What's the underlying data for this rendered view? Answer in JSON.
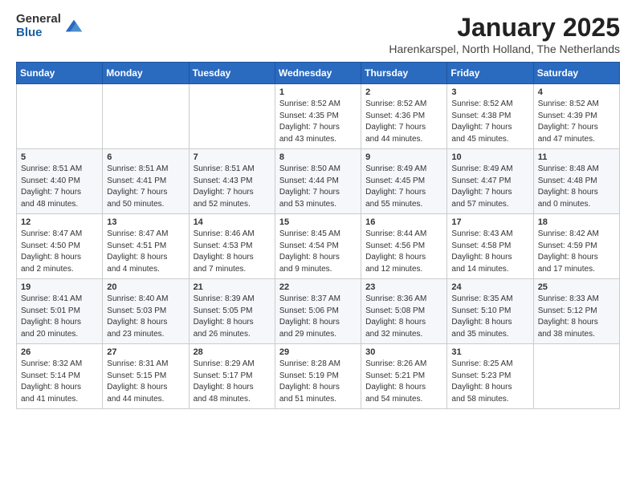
{
  "logo": {
    "general": "General",
    "blue": "Blue"
  },
  "title": "January 2025",
  "subtitle": "Harenkarspel, North Holland, The Netherlands",
  "headers": [
    "Sunday",
    "Monday",
    "Tuesday",
    "Wednesday",
    "Thursday",
    "Friday",
    "Saturday"
  ],
  "weeks": [
    [
      {
        "day": "",
        "content": ""
      },
      {
        "day": "",
        "content": ""
      },
      {
        "day": "",
        "content": ""
      },
      {
        "day": "1",
        "content": "Sunrise: 8:52 AM\nSunset: 4:35 PM\nDaylight: 7 hours\nand 43 minutes."
      },
      {
        "day": "2",
        "content": "Sunrise: 8:52 AM\nSunset: 4:36 PM\nDaylight: 7 hours\nand 44 minutes."
      },
      {
        "day": "3",
        "content": "Sunrise: 8:52 AM\nSunset: 4:38 PM\nDaylight: 7 hours\nand 45 minutes."
      },
      {
        "day": "4",
        "content": "Sunrise: 8:52 AM\nSunset: 4:39 PM\nDaylight: 7 hours\nand 47 minutes."
      }
    ],
    [
      {
        "day": "5",
        "content": "Sunrise: 8:51 AM\nSunset: 4:40 PM\nDaylight: 7 hours\nand 48 minutes."
      },
      {
        "day": "6",
        "content": "Sunrise: 8:51 AM\nSunset: 4:41 PM\nDaylight: 7 hours\nand 50 minutes."
      },
      {
        "day": "7",
        "content": "Sunrise: 8:51 AM\nSunset: 4:43 PM\nDaylight: 7 hours\nand 52 minutes."
      },
      {
        "day": "8",
        "content": "Sunrise: 8:50 AM\nSunset: 4:44 PM\nDaylight: 7 hours\nand 53 minutes."
      },
      {
        "day": "9",
        "content": "Sunrise: 8:49 AM\nSunset: 4:45 PM\nDaylight: 7 hours\nand 55 minutes."
      },
      {
        "day": "10",
        "content": "Sunrise: 8:49 AM\nSunset: 4:47 PM\nDaylight: 7 hours\nand 57 minutes."
      },
      {
        "day": "11",
        "content": "Sunrise: 8:48 AM\nSunset: 4:48 PM\nDaylight: 8 hours\nand 0 minutes."
      }
    ],
    [
      {
        "day": "12",
        "content": "Sunrise: 8:47 AM\nSunset: 4:50 PM\nDaylight: 8 hours\nand 2 minutes."
      },
      {
        "day": "13",
        "content": "Sunrise: 8:47 AM\nSunset: 4:51 PM\nDaylight: 8 hours\nand 4 minutes."
      },
      {
        "day": "14",
        "content": "Sunrise: 8:46 AM\nSunset: 4:53 PM\nDaylight: 8 hours\nand 7 minutes."
      },
      {
        "day": "15",
        "content": "Sunrise: 8:45 AM\nSunset: 4:54 PM\nDaylight: 8 hours\nand 9 minutes."
      },
      {
        "day": "16",
        "content": "Sunrise: 8:44 AM\nSunset: 4:56 PM\nDaylight: 8 hours\nand 12 minutes."
      },
      {
        "day": "17",
        "content": "Sunrise: 8:43 AM\nSunset: 4:58 PM\nDaylight: 8 hours\nand 14 minutes."
      },
      {
        "day": "18",
        "content": "Sunrise: 8:42 AM\nSunset: 4:59 PM\nDaylight: 8 hours\nand 17 minutes."
      }
    ],
    [
      {
        "day": "19",
        "content": "Sunrise: 8:41 AM\nSunset: 5:01 PM\nDaylight: 8 hours\nand 20 minutes."
      },
      {
        "day": "20",
        "content": "Sunrise: 8:40 AM\nSunset: 5:03 PM\nDaylight: 8 hours\nand 23 minutes."
      },
      {
        "day": "21",
        "content": "Sunrise: 8:39 AM\nSunset: 5:05 PM\nDaylight: 8 hours\nand 26 minutes."
      },
      {
        "day": "22",
        "content": "Sunrise: 8:37 AM\nSunset: 5:06 PM\nDaylight: 8 hours\nand 29 minutes."
      },
      {
        "day": "23",
        "content": "Sunrise: 8:36 AM\nSunset: 5:08 PM\nDaylight: 8 hours\nand 32 minutes."
      },
      {
        "day": "24",
        "content": "Sunrise: 8:35 AM\nSunset: 5:10 PM\nDaylight: 8 hours\nand 35 minutes."
      },
      {
        "day": "25",
        "content": "Sunrise: 8:33 AM\nSunset: 5:12 PM\nDaylight: 8 hours\nand 38 minutes."
      }
    ],
    [
      {
        "day": "26",
        "content": "Sunrise: 8:32 AM\nSunset: 5:14 PM\nDaylight: 8 hours\nand 41 minutes."
      },
      {
        "day": "27",
        "content": "Sunrise: 8:31 AM\nSunset: 5:15 PM\nDaylight: 8 hours\nand 44 minutes."
      },
      {
        "day": "28",
        "content": "Sunrise: 8:29 AM\nSunset: 5:17 PM\nDaylight: 8 hours\nand 48 minutes."
      },
      {
        "day": "29",
        "content": "Sunrise: 8:28 AM\nSunset: 5:19 PM\nDaylight: 8 hours\nand 51 minutes."
      },
      {
        "day": "30",
        "content": "Sunrise: 8:26 AM\nSunset: 5:21 PM\nDaylight: 8 hours\nand 54 minutes."
      },
      {
        "day": "31",
        "content": "Sunrise: 8:25 AM\nSunset: 5:23 PM\nDaylight: 8 hours\nand 58 minutes."
      },
      {
        "day": "",
        "content": ""
      }
    ]
  ]
}
